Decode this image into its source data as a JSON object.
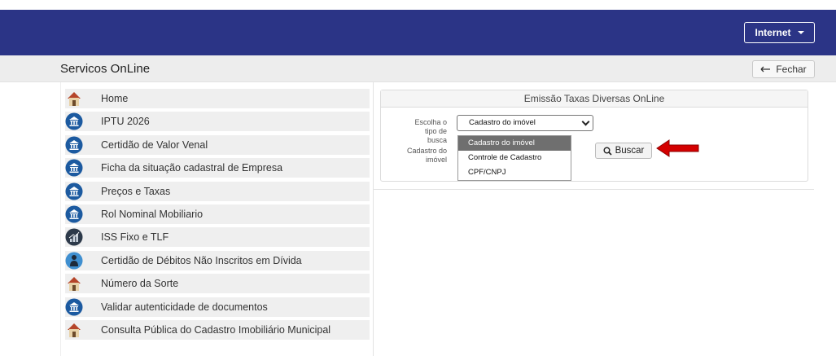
{
  "header": {
    "internet_label": "Internet"
  },
  "subheader": {
    "title": "Servicos OnLine",
    "close_label": "Fechar"
  },
  "menu": [
    {
      "label": "Home",
      "icon": "house-icon"
    },
    {
      "label": "IPTU 2026",
      "icon": "bank-icon"
    },
    {
      "label": "Certidão de Valor Venal",
      "icon": "bank-icon"
    },
    {
      "label": "Ficha da situação cadastral de Empresa",
      "icon": "bank-icon"
    },
    {
      "label": "Preços e Taxas",
      "icon": "bank-icon"
    },
    {
      "label": "Rol Nominal Mobiliario",
      "icon": "bank-icon"
    },
    {
      "label": "ISS Fixo e TLF",
      "icon": "chart-icon"
    },
    {
      "label": "Certidão de Débitos Não Inscritos em Dívida",
      "icon": "person-icon"
    },
    {
      "label": "Número da Sorte",
      "icon": "house-icon"
    },
    {
      "label": "Validar autenticidade de documentos",
      "icon": "bank-icon"
    },
    {
      "label": "Consulta Pública do Cadastro Imobiliário Municipal",
      "icon": "house-icon"
    }
  ],
  "form": {
    "title": "Emissão Taxas Diversas OnLine",
    "search_type_label_1": "Escolha o",
    "search_type_label_2": "tipo de busca",
    "selected_value": "Cadastro do imóvel",
    "cadastro_label_1": "Cadastro do",
    "cadastro_label_2": "imóvel",
    "options": [
      "Cadastro do imóvel",
      "Controle de Cadastro",
      "CPF/CNPJ"
    ],
    "search_button": "Buscar"
  },
  "colors": {
    "header_bg": "#2b3486",
    "arrow": "#d40000",
    "bank_icon": "#1c5aa0"
  }
}
